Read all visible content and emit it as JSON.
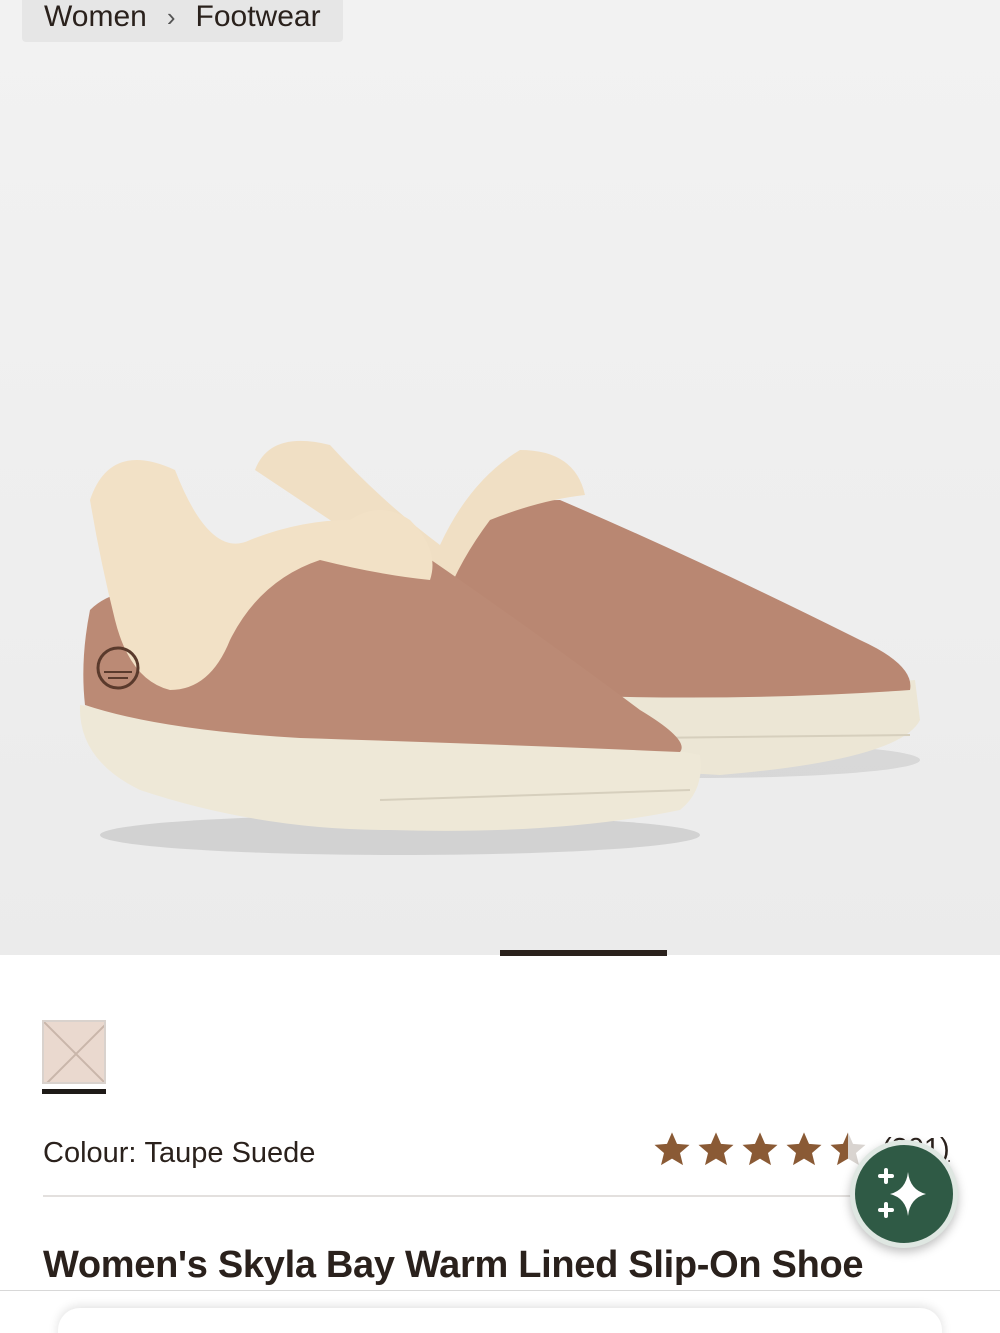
{
  "breadcrumb": {
    "items": [
      "Women",
      "Footwear"
    ],
    "separator": "›"
  },
  "gallery": {
    "image_name": "taupe-suede-slip-on-shoe"
  },
  "swatch": {
    "selected_colour": "Taupe Suede"
  },
  "colour": {
    "label": "Colour:",
    "value": "Taupe Suede"
  },
  "rating": {
    "stars": 4.5,
    "max": 5,
    "count": "(301)",
    "star_color": "#8a5a35"
  },
  "assistant": {
    "icon": "sparkle-icon",
    "color": "#2f5a45"
  },
  "product": {
    "title": "Women's Skyla Bay Warm Lined Slip-On Shoe"
  }
}
